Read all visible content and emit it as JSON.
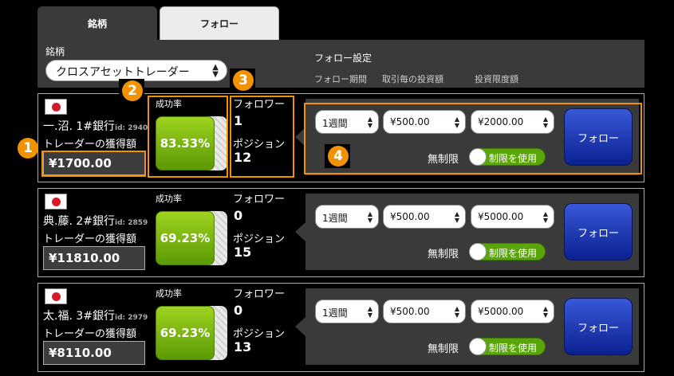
{
  "tabs": [
    {
      "label": "銘柄",
      "active": true
    },
    {
      "label": "フォロー",
      "active": false
    }
  ],
  "filter": {
    "label": "銘柄",
    "asset_value": "クロスアセットトレーダー",
    "follow_settings_label": "フォロー設定",
    "columns": [
      "フォロー期間",
      "取引毎の投資額",
      "投資限度額"
    ]
  },
  "labels": {
    "earnings": "トレーダーの獲得額",
    "success_rate": "成功率",
    "followers": "フォロワー",
    "positions": "ポジション",
    "unlimited": "無制限",
    "use_limit": "制限を使用",
    "follow_button": "フォロー"
  },
  "traders": [
    {
      "name": "一.沼.",
      "rank": "1#",
      "bank": "銀行",
      "id": "id: 2940",
      "earnings": "¥1700.00",
      "success_rate": "83.33%",
      "followers": "1",
      "positions": "12",
      "period": "1週間",
      "per_trade": "¥500.00",
      "limit": "¥2000.00"
    },
    {
      "name": "典.藤.",
      "rank": "2#",
      "bank": "銀行",
      "id": "id: 2859",
      "earnings": "¥11810.00",
      "success_rate": "69.23%",
      "followers": "0",
      "positions": "15",
      "period": "1週間",
      "per_trade": "¥500.00",
      "limit": "¥5000.00"
    },
    {
      "name": "太.福.",
      "rank": "3#",
      "bank": "銀行",
      "id": "id: 2979",
      "earnings": "¥8110.00",
      "success_rate": "69.23%",
      "followers": "0",
      "positions": "13",
      "period": "1週間",
      "per_trade": "¥500.00",
      "limit": "¥5000.00"
    }
  ],
  "annotations": [
    "1",
    "2",
    "3",
    "4"
  ],
  "colors": {
    "accent": "#f19200",
    "success": "#6fb00f",
    "button": "#1a36b0"
  }
}
